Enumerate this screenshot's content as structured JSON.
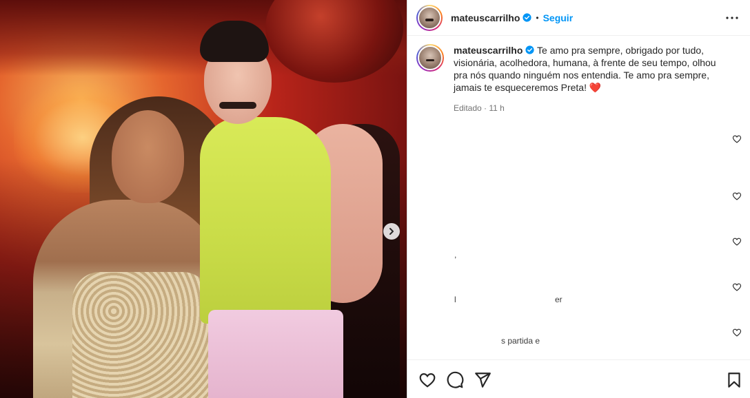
{
  "post": {
    "username": "mateuscarrilho",
    "verified": true,
    "separator": "•",
    "follow_label": "Seguir",
    "caption": "Te amo pra sempre, obrigado por tudo, visionária, acolhedora, humana, à frente de seu tempo, olhou pra nós quando ninguém nos entendia. Te amo pra sempre, jamais te esqueceremos Preta! ❤️",
    "edited_label": "Editado",
    "meta_separator": "·",
    "time_ago": "11 h"
  },
  "comments": {
    "fragments": [
      ",",
      "l",
      "er",
      "s partida e"
    ]
  },
  "icons": {
    "more": "more-horizontal-icon",
    "next": "chevron-right-icon",
    "like": "heart-icon",
    "comment": "comment-bubble-icon",
    "share": "paper-plane-icon",
    "save": "bookmark-icon",
    "verified": "verified-badge-icon"
  },
  "colors": {
    "follow": "#0095f6",
    "verified": "#0095f6",
    "text": "#262626",
    "muted": "#737373"
  }
}
